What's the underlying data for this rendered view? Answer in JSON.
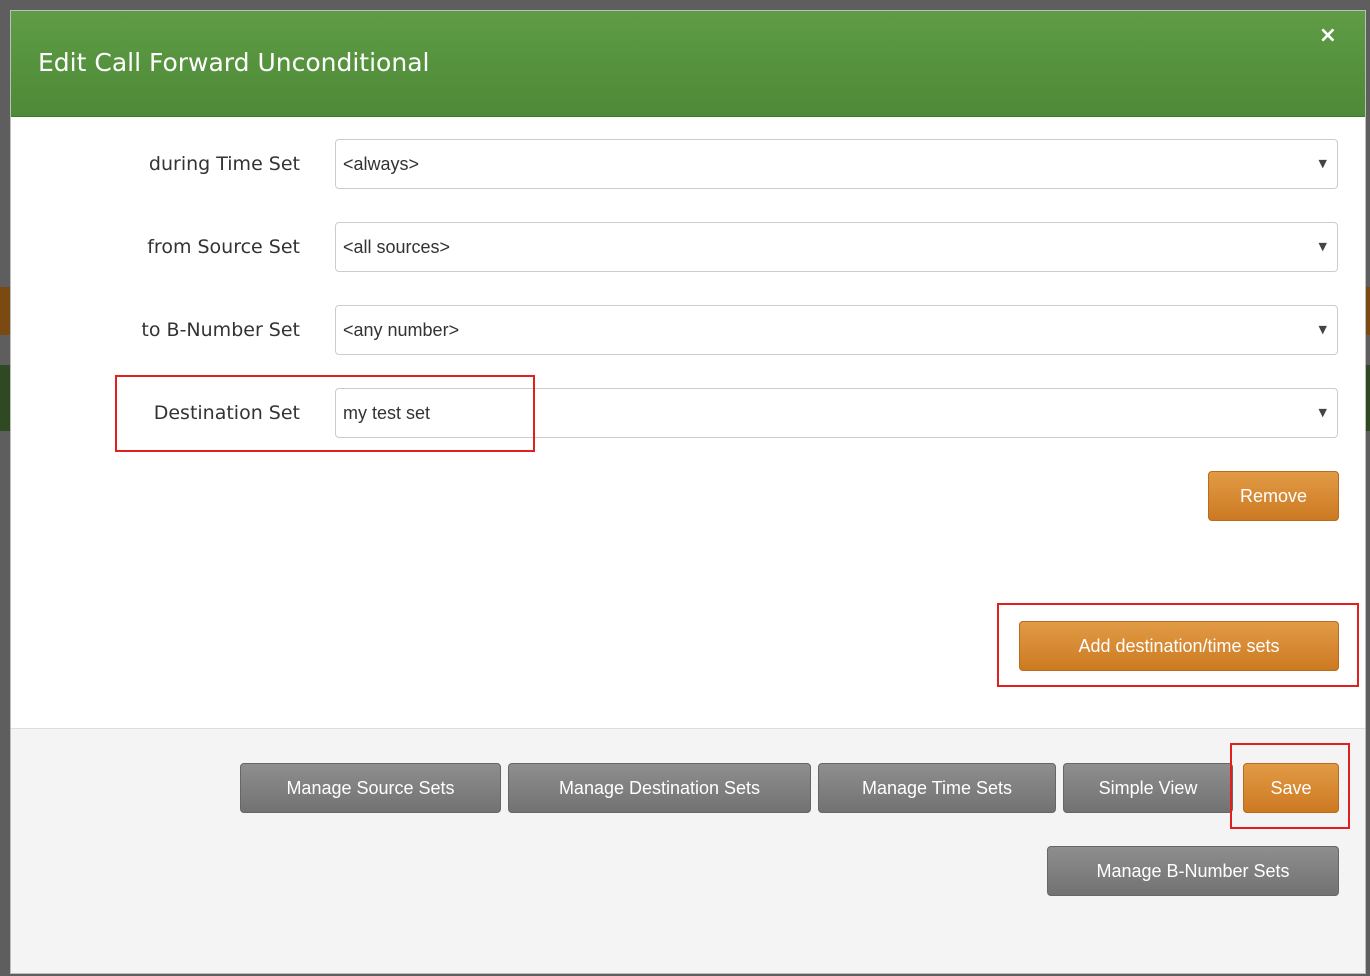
{
  "dialog": {
    "title": "Edit Call Forward Unconditional",
    "close_glyph": "×"
  },
  "form": {
    "rows": [
      {
        "label": "during Time Set",
        "value": "<always>"
      },
      {
        "label": "from Source Set",
        "value": "<all sources>"
      },
      {
        "label": "to B-Number Set",
        "value": "<any number>"
      },
      {
        "label": "Destination Set",
        "value": "my test set"
      }
    ],
    "caret_glyph": "▼",
    "remove_label": "Remove",
    "add_sets_label": "Add destination/time sets"
  },
  "footer": {
    "manage_source_sets": "Manage Source Sets",
    "manage_destination_sets": "Manage Destination Sets",
    "manage_time_sets": "Manage Time Sets",
    "simple_view": "Simple View",
    "save": "Save",
    "manage_bnumber_sets": "Manage B-Number Sets"
  },
  "colors": {
    "header_green": "#5a9641",
    "button_orange": "#d9882f",
    "button_gray": "#808080",
    "highlight_red": "#e02020"
  }
}
